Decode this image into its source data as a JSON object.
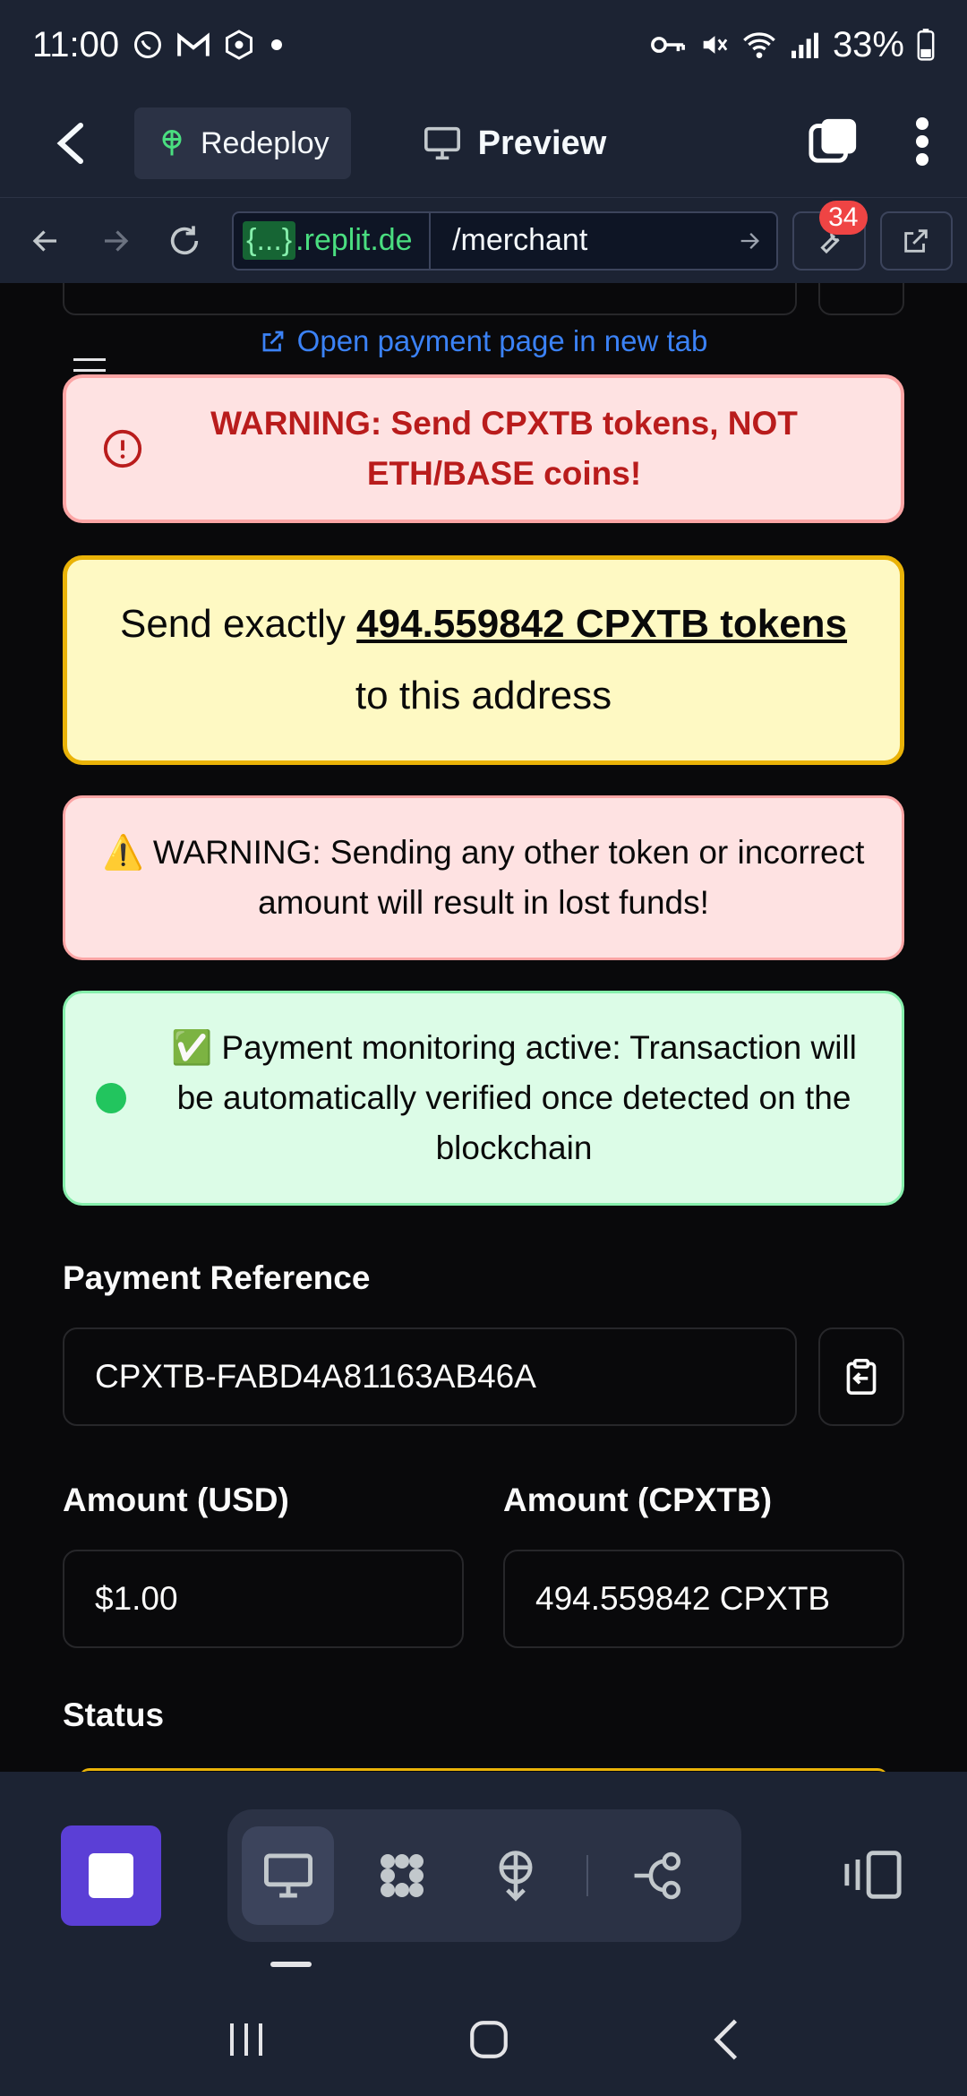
{
  "status_bar": {
    "time": "11:00",
    "battery": "33%"
  },
  "header": {
    "redeploy_label": "Redeploy",
    "preview_label": "Preview"
  },
  "url_bar": {
    "domain": ".replit.de",
    "domain_prefix": "{...}",
    "path": "/merchant",
    "badge_count": "34"
  },
  "page": {
    "open_link": "Open payment page in new tab",
    "warning_top": "WARNING: Send CPXTB tokens, NOT ETH/BASE coins!",
    "send_prefix": "Send exactly",
    "send_amount": "494.559842 CPXTB tokens",
    "send_suffix": "to this address",
    "warning_lost": "⚠️ WARNING: Sending any other token or incorrect amount will result in lost funds!",
    "monitoring": "✅ Payment monitoring active: Transaction will be automatically verified once detected on the blockchain",
    "payment_reference_label": "Payment Reference",
    "payment_reference_value": "CPXTB-FABD4A81163AB46A",
    "amount_usd_label": "Amount (USD)",
    "amount_usd_value": "$1.00",
    "amount_cpxtb_label": "Amount (CPXTB)",
    "amount_cpxtb_value": "494.559842 CPXTB",
    "status_label": "Status"
  },
  "colors": {
    "accent": "#5b3fd6",
    "warning_red": "#b91c1c",
    "link_blue": "#3b82f6",
    "success_green": "#22c55e",
    "highlight_yellow": "#eab308"
  }
}
